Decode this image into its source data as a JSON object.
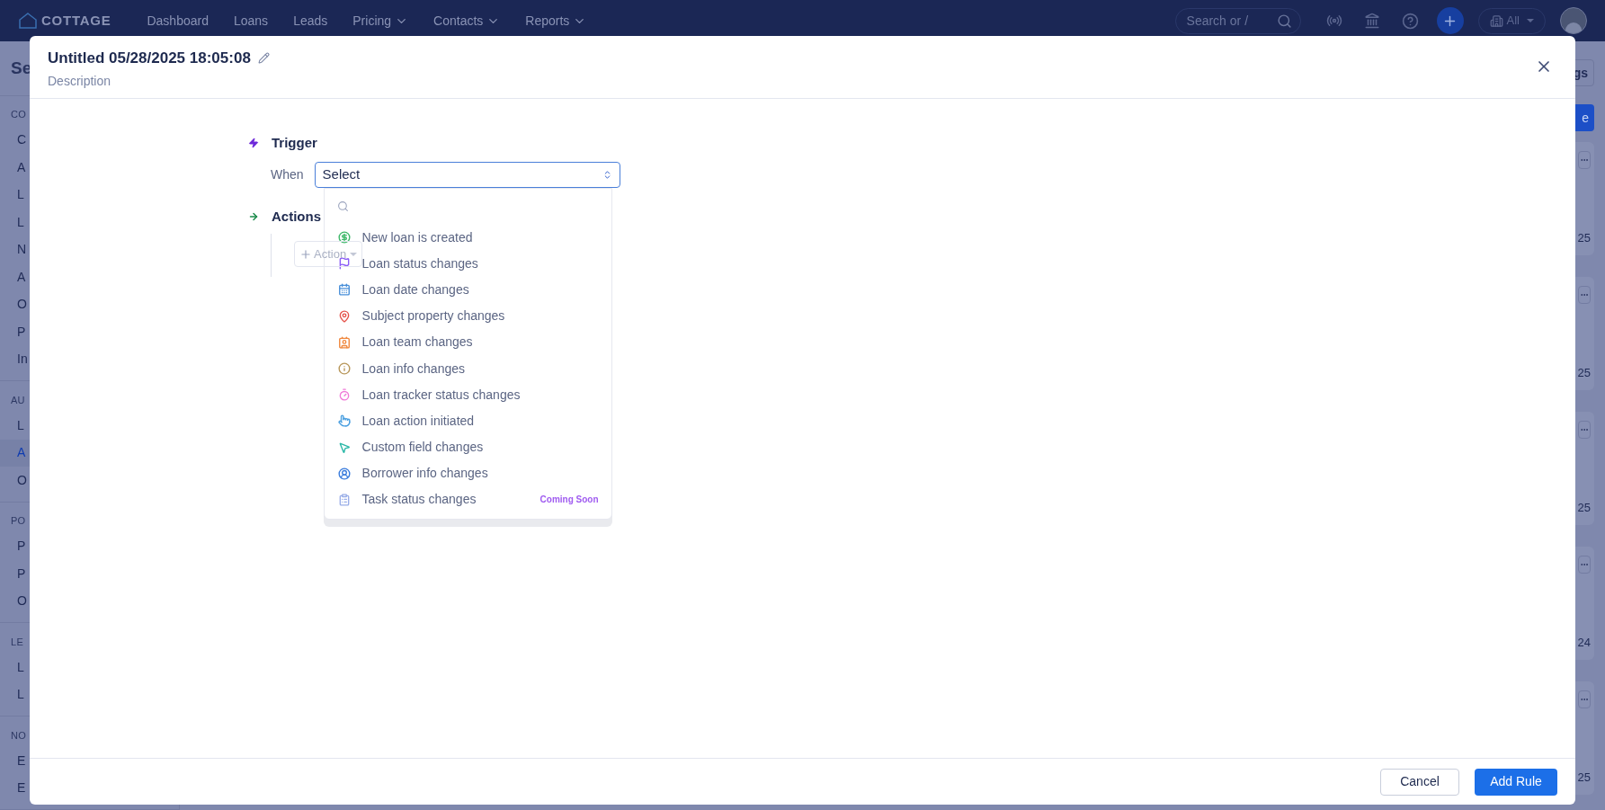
{
  "nav": {
    "logo": "COTTAGE",
    "items": [
      {
        "label": "Dashboard",
        "dropdown": false
      },
      {
        "label": "Loans",
        "dropdown": false
      },
      {
        "label": "Leads",
        "dropdown": false
      },
      {
        "label": "Pricing",
        "dropdown": true
      },
      {
        "label": "Contacts",
        "dropdown": true
      },
      {
        "label": "Reports",
        "dropdown": true
      }
    ],
    "search": {
      "placeholder": "Search or /"
    },
    "org": "All"
  },
  "background": {
    "title": "Se",
    "sections": [
      {
        "label": "CO",
        "items": [
          {
            "label": "C",
            "selected": false
          },
          {
            "label": "A",
            "selected": false
          },
          {
            "label": "L",
            "selected": false
          },
          {
            "label": "L",
            "selected": false
          },
          {
            "label": "N",
            "selected": false
          },
          {
            "label": "A",
            "selected": false
          },
          {
            "label": "O",
            "selected": false
          },
          {
            "label": "P",
            "selected": false
          },
          {
            "label": "In",
            "selected": false
          }
        ]
      },
      {
        "label": "AU",
        "items": [
          {
            "label": "L",
            "selected": false
          },
          {
            "label": "A",
            "selected": true
          },
          {
            "label": "O",
            "selected": false
          }
        ]
      },
      {
        "label": "PO",
        "items": [
          {
            "label": "P",
            "selected": false
          },
          {
            "label": "P",
            "selected": false
          },
          {
            "label": "O",
            "selected": false
          }
        ]
      },
      {
        "label": "LE",
        "items": [
          {
            "label": "L",
            "selected": false
          },
          {
            "label": "L",
            "selected": false
          }
        ]
      },
      {
        "label": "NO",
        "items": [
          {
            "label": "E",
            "selected": false
          },
          {
            "label": "E",
            "selected": false
          }
        ]
      }
    ],
    "top_button": "gs",
    "primary_button": "e",
    "cards": [
      {
        "date": "25"
      },
      {
        "date": "25"
      },
      {
        "date": "25"
      },
      {
        "date": "24"
      },
      {
        "date": "25"
      }
    ]
  },
  "modal": {
    "title": "Untitled 05/28/2025 18:05:08",
    "description": "Description",
    "trigger": {
      "heading": "Trigger",
      "when_label": "When",
      "select_value": "Select"
    },
    "dropdown": {
      "options": [
        {
          "label": "New loan is created"
        },
        {
          "label": "Loan status changes"
        },
        {
          "label": "Loan date changes"
        },
        {
          "label": "Subject property changes"
        },
        {
          "label": "Loan team changes"
        },
        {
          "label": "Loan info changes"
        },
        {
          "label": "Loan tracker status changes"
        },
        {
          "label": "Loan action initiated"
        },
        {
          "label": "Custom field changes"
        },
        {
          "label": "Borrower info changes"
        },
        {
          "label": "Task status changes",
          "badge": "Coming Soon"
        }
      ]
    },
    "actions": {
      "heading": "Actions",
      "add_button": "Action"
    },
    "footer": {
      "cancel": "Cancel",
      "submit": "Add Rule"
    }
  }
}
